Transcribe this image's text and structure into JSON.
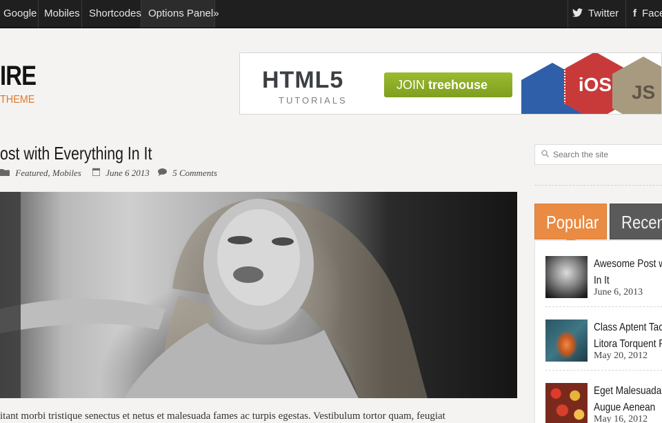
{
  "nav": {
    "items": [
      {
        "label": "Google"
      },
      {
        "label": "Mobiles"
      },
      {
        "label": "Shortcodes"
      },
      {
        "label": "Options Panel"
      }
    ],
    "options_arrow": "»",
    "social": [
      {
        "label": "Twitter",
        "icon": "twitter-icon"
      },
      {
        "label": "Faceb",
        "icon": "facebook-icon"
      }
    ]
  },
  "header": {
    "logo_text": "IRE",
    "logo_sub": "THEME",
    "accent": "#e07a2c"
  },
  "banner": {
    "headline": "HTML5",
    "subline": "TUTORIALS",
    "cta_prefix": "JOIN",
    "cta_brand": "treehouse",
    "badges": [
      {
        "label": "",
        "color": "#2f5fa8"
      },
      {
        "label": "iOS",
        "color": "#c83a3a"
      },
      {
        "label": "JS",
        "color": "#a79a7f"
      }
    ]
  },
  "post": {
    "title": "ost with Everything In It",
    "categories": "Featured, Mobiles",
    "date": "June 6 2013",
    "comments": "5 Comments",
    "excerpt": "itant morbi tristique senectus et netus et malesuada fames ac turpis egestas. Vestibulum tortor quam, feugiat"
  },
  "sidebar": {
    "search_placeholder": "Search the site",
    "tabs": [
      {
        "label": "Popular",
        "active": true
      },
      {
        "label": "Recen",
        "active": false
      }
    ],
    "popular": [
      {
        "title_line1": "Awesome Post w",
        "title_line2": "In It",
        "date": "June 6, 2013"
      },
      {
        "title_line1": "Class Aptent Tac",
        "title_line2": "Litora Torquent P",
        "date": "May 20, 2012"
      },
      {
        "title_line1": "Eget Malesuada",
        "title_line2": "Augue Aenean",
        "date": "May 16, 2012"
      }
    ]
  }
}
